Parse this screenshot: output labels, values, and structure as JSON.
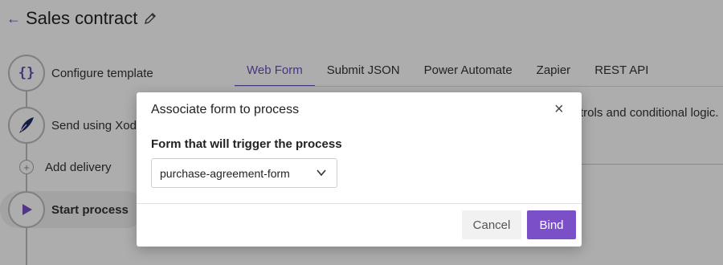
{
  "header": {
    "title": "Sales contract"
  },
  "steps": [
    {
      "label": "Configure template",
      "icon": "braces-icon"
    },
    {
      "label": "Send using Xodo",
      "icon": "quill-icon"
    },
    {
      "label": "Add delivery",
      "icon": "plus-icon"
    },
    {
      "label": "Start process",
      "icon": "play-icon"
    }
  ],
  "tabs": [
    "Web Form",
    "Submit JSON",
    "Power Automate",
    "Zapier",
    "REST API"
  ],
  "content": {
    "text": "trols and conditional logic."
  },
  "modal": {
    "title": "Associate form to process",
    "field_label": "Form that will trigger the process",
    "select_value": "purchase-agreement-form",
    "cancel_label": "Cancel",
    "bind_label": "Bind"
  },
  "colors": {
    "accent": "#6b4fbb",
    "primary_button": "#7a4fc8"
  }
}
